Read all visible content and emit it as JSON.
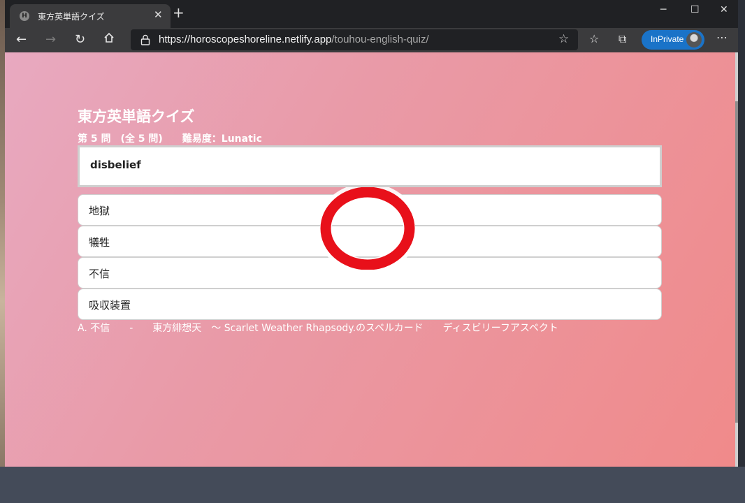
{
  "browser": {
    "tab_title": "東方英単語クイズ",
    "tab_favicon_letter": "H",
    "url_host": "https://horoscopeshoreline.netlify.app",
    "url_path": "/touhou-english-quiz/",
    "inprivate_label": "InPrivate"
  },
  "quiz": {
    "title": "東方英単語クイズ",
    "meta": "第 5 問　(全 5 問)　　難易度：Lunatic",
    "word": "disbelief",
    "choices": [
      "地獄",
      "犠牲",
      "不信",
      "吸収装置"
    ],
    "answer_line": "A. 不信　　-　　東方緋想天　～ Scarlet Weather Rhapsody.のスペルカード　　ディスビリーフアスペクト",
    "result_mark": "correct",
    "mark_color": "#e8101a"
  }
}
